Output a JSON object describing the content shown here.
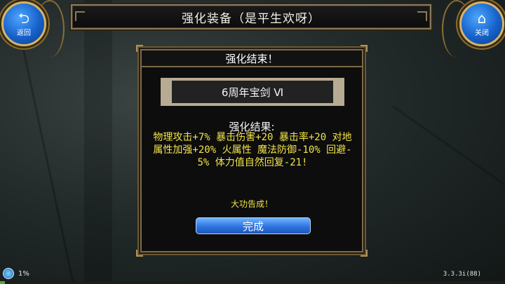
{
  "header": {
    "title": "强化装备（是平生欢呀）"
  },
  "buttons": {
    "back": {
      "icon": "back-arrow-icon",
      "label": "返回"
    },
    "close": {
      "icon": "home-icon",
      "label": "关闭"
    }
  },
  "dialog": {
    "title": "强化结束！",
    "item_name": "6周年宝剑 Ⅵ",
    "result_label": "强化结果:",
    "result_text": "物理攻击+7% 暴击伤害+20 暴击率+20 对地属性加强+20% 火属性 魔法防御-10% 回避-5% 体力值自然回复-21!",
    "success_text": "大功告成！",
    "done_button": "完成"
  },
  "status": {
    "percent_text": "1%",
    "progress": 0.01,
    "version": "3.3.3i(88)"
  },
  "colors": {
    "accent_blue": "#2f74e0",
    "frame_gold": "#8a7a5a",
    "result_yellow": "#f2e34a"
  }
}
